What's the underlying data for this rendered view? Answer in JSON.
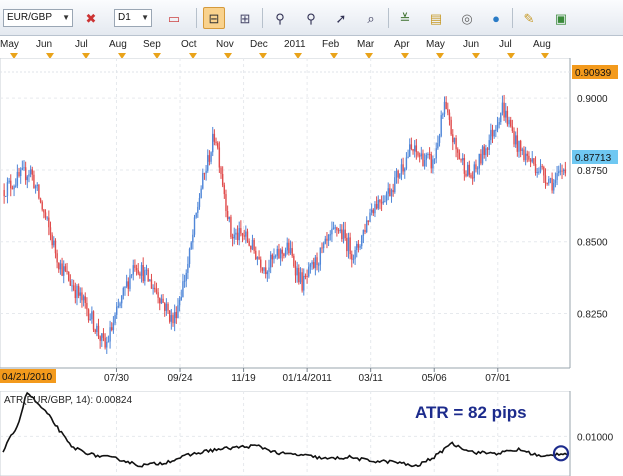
{
  "toolbar": {
    "symbol": "EUR/GBP",
    "timeframe": "D1",
    "icons": [
      "bar-chart-icon",
      "crosshair-icon",
      "line-icon",
      "candlestick-icon",
      "zoom-icon",
      "line-study-icon",
      "arrow-icon",
      "zoom-in-icon",
      "fibonacci-icon",
      "properties-icon",
      "indicator-icon",
      "globe-icon",
      "ruler-icon",
      "image-icon"
    ]
  },
  "month_axis": [
    "May",
    "Jun",
    "Jul",
    "Aug",
    "Sep",
    "Oct",
    "Nov",
    "Dec",
    "2011",
    "Feb",
    "Mar",
    "Apr",
    "May",
    "Jun",
    "Jul",
    "Aug"
  ],
  "chart_data": [
    {
      "type": "candlestick",
      "symbol": "EUR/GBP",
      "timeframe": "D1",
      "price_ticks": [
        "0.9000",
        "0.8750",
        "0.8500",
        "0.8250"
      ],
      "ylim": [
        0.806,
        0.914
      ],
      "date_ticks": [
        "07/30",
        "09/24",
        "11/19",
        "01/14/2011",
        "03/11",
        "05/06",
        "07/01"
      ],
      "start_date_label": "04/21/2010",
      "high_label": "0.90939",
      "last_label": "0.87713",
      "up_color": "#4f86d8",
      "down_color": "#e04b4b",
      "grid": true,
      "x": [
        "2010-04-21",
        "2010-05-15",
        "2010-06-10",
        "2010-07-05",
        "2010-07-20",
        "2010-08-15",
        "2010-09-05",
        "2010-09-18",
        "2010-10-01",
        "2010-10-12",
        "2010-10-25",
        "2010-11-08",
        "2010-11-20",
        "2010-12-08",
        "2010-12-28",
        "2011-01-10",
        "2011-01-25",
        "2011-02-10",
        "2011-02-25",
        "2011-03-12",
        "2011-03-28",
        "2011-04-15",
        "2011-05-05",
        "2011-05-15",
        "2011-05-25",
        "2011-06-08",
        "2011-06-25",
        "2011-07-05",
        "2011-07-20",
        "2011-08-05",
        "2011-08-20",
        "2011-08-30"
      ],
      "close": [
        0.868,
        0.875,
        0.842,
        0.826,
        0.813,
        0.843,
        0.832,
        0.822,
        0.842,
        0.868,
        0.888,
        0.852,
        0.852,
        0.841,
        0.848,
        0.835,
        0.845,
        0.855,
        0.845,
        0.862,
        0.868,
        0.882,
        0.877,
        0.897,
        0.882,
        0.872,
        0.887,
        0.897,
        0.882,
        0.876,
        0.87,
        0.877
      ]
    },
    {
      "type": "line",
      "indicator": "ATR",
      "label": "ATR(EUR/GBP, 14): 0.00824",
      "annotation": "ATR = 82 pips",
      "y_tick": "0.01000",
      "ylim": [
        0.0058,
        0.0148
      ],
      "x": [
        "2010-04-21",
        "2010-05-05",
        "2010-05-12",
        "2010-06-01",
        "2010-06-20",
        "2010-07-10",
        "2010-08-01",
        "2010-08-20",
        "2010-09-10",
        "2010-10-01",
        "2010-10-20",
        "2010-11-10",
        "2010-12-01",
        "2010-12-20",
        "2011-01-10",
        "2011-02-01",
        "2011-02-20",
        "2011-03-10",
        "2011-04-01",
        "2011-04-20",
        "2011-05-10",
        "2011-05-20",
        "2011-06-10",
        "2011-07-01",
        "2011-07-20",
        "2011-08-10",
        "2011-08-25"
      ],
      "values": [
        0.0084,
        0.0115,
        0.0147,
        0.0121,
        0.0089,
        0.008,
        0.0076,
        0.0069,
        0.0072,
        0.008,
        0.0085,
        0.0088,
        0.009,
        0.0082,
        0.008,
        0.0076,
        0.0078,
        0.0074,
        0.0073,
        0.0068,
        0.0081,
        0.0093,
        0.0083,
        0.0082,
        0.0086,
        0.0078,
        0.0082
      ]
    }
  ]
}
